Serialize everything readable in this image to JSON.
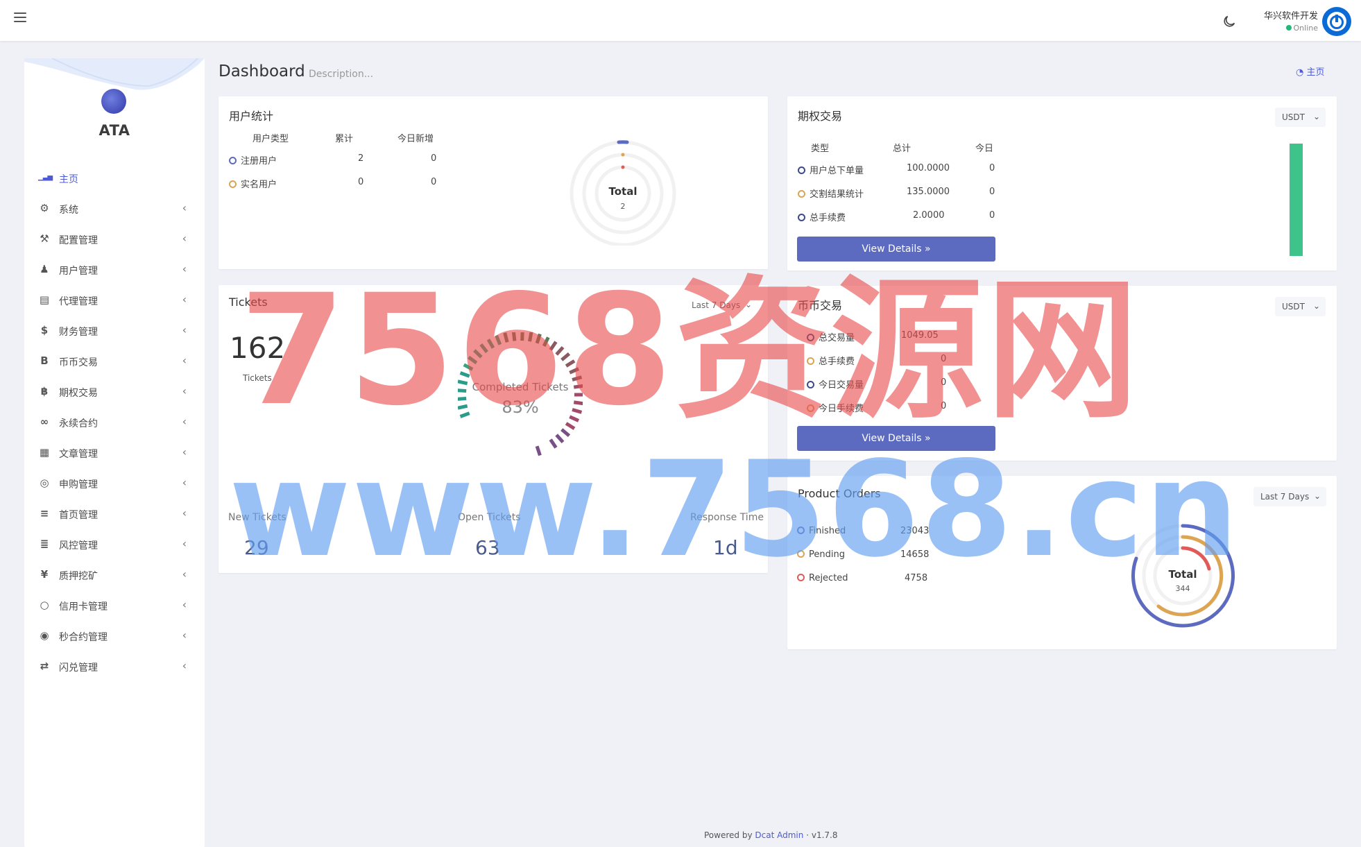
{
  "navbar": {
    "user_name": "华兴软件开发",
    "user_status": "Online"
  },
  "sidebar": {
    "brand": "ATA",
    "items": [
      {
        "label": "主页",
        "icon": "bar-chart-icon",
        "active": true
      },
      {
        "label": "系统",
        "icon": "gear-icon"
      },
      {
        "label": "配置管理",
        "icon": "wrench-icon"
      },
      {
        "label": "用户管理",
        "icon": "user-tie-icon"
      },
      {
        "label": "代理管理",
        "icon": "id-card-icon"
      },
      {
        "label": "财务管理",
        "icon": "dollar-icon"
      },
      {
        "label": "币币交易",
        "icon": "b-icon"
      },
      {
        "label": "期权交易",
        "icon": "bitcoin-icon"
      },
      {
        "label": "永续合约",
        "icon": "link-icon"
      },
      {
        "label": "文章管理",
        "icon": "newspaper-icon"
      },
      {
        "label": "申购管理",
        "icon": "life-ring-icon"
      },
      {
        "label": "首页管理",
        "icon": "list-icon"
      },
      {
        "label": "风控管理",
        "icon": "indent-icon"
      },
      {
        "label": "质押挖矿",
        "icon": "yen-icon"
      },
      {
        "label": "信用卡管理",
        "icon": "circle-icon"
      },
      {
        "label": "秒合约管理",
        "icon": "coins-icon"
      },
      {
        "label": "闪兑管理",
        "icon": "exchange-icon"
      }
    ]
  },
  "header": {
    "title": "Dashboard",
    "description": "Description...",
    "breadcrumb": "主页"
  },
  "user_stats": {
    "title": "用户统计",
    "columns": [
      "用户类型",
      "累计",
      "今日新增"
    ],
    "rows": [
      {
        "type": "注册用户",
        "total": "2",
        "today": "0",
        "color": "#5c6bc0"
      },
      {
        "type": "实名用户",
        "total": "0",
        "today": "0",
        "color": "#dda451"
      }
    ],
    "chart_total_label": "Total",
    "chart_total_value": "2"
  },
  "options_trade": {
    "title": "期权交易",
    "currency": "USDT",
    "columns": [
      "类型",
      "总计",
      "今日"
    ],
    "rows": [
      {
        "type": "用户总下单量",
        "total": "100.0000",
        "today": "0",
        "color": "#3b4a8c"
      },
      {
        "type": "交割结果统计",
        "total": "135.0000",
        "today": "0",
        "color": "#dda451"
      },
      {
        "type": "总手续费",
        "total": "2.0000",
        "today": "0",
        "color": "#3b4a8c"
      }
    ],
    "button": "View Details »"
  },
  "tickets": {
    "title": "Tickets",
    "range": "Last 7 Days",
    "count": "162",
    "count_label": "Tickets",
    "gauge_label": "Completed Tickets",
    "gauge_value": "83%",
    "gauge_fraction": 0.83,
    "stats": [
      {
        "label": "New Tickets",
        "value": "29"
      },
      {
        "label": "Open Tickets",
        "value": "63"
      },
      {
        "label": "Response Time",
        "value": "1d"
      }
    ]
  },
  "spot_trade": {
    "title": "币币交易",
    "currency": "USDT",
    "rows": [
      {
        "type": "总交易量",
        "value": "1049.05",
        "color": "#3b4a8c"
      },
      {
        "type": "总手续费",
        "value": "0",
        "color": "#dda451"
      },
      {
        "type": "今日交易量",
        "value": "0",
        "color": "#3b4a8c"
      },
      {
        "type": "今日手续费",
        "value": "0",
        "color": "#dda451"
      }
    ],
    "button": "View Details »"
  },
  "product_orders": {
    "title": "Product Orders",
    "range": "Last 7 Days",
    "rows": [
      {
        "label": "Finished",
        "value": "23043",
        "color": "#5c6bc0"
      },
      {
        "label": "Pending",
        "value": "14658",
        "color": "#dda451"
      },
      {
        "label": "Rejected",
        "value": "4758",
        "color": "#e05a5a"
      }
    ],
    "chart_total_label": "Total",
    "chart_total_value": "344"
  },
  "footer": {
    "prefix": "Powered by",
    "link": "Dcat Admin",
    "sep": "·",
    "version": "v1.7.8"
  },
  "watermark": {
    "line1": "7568资源网",
    "line2": "www.7568.cn"
  },
  "colors": {
    "primary": "#5c6bc0",
    "accent": "#4d5ad8",
    "success": "#21b978",
    "warning": "#dda451",
    "danger": "#e05a5a"
  }
}
